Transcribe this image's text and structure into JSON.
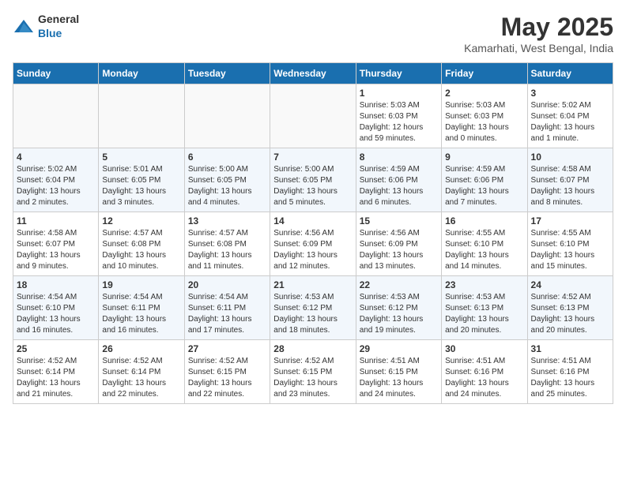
{
  "header": {
    "logo": {
      "general": "General",
      "blue": "Blue"
    },
    "title": "May 2025",
    "location": "Kamarhati, West Bengal, India"
  },
  "calendar": {
    "days_of_week": [
      "Sunday",
      "Monday",
      "Tuesday",
      "Wednesday",
      "Thursday",
      "Friday",
      "Saturday"
    ],
    "weeks": [
      [
        {
          "day": "",
          "info": ""
        },
        {
          "day": "",
          "info": ""
        },
        {
          "day": "",
          "info": ""
        },
        {
          "day": "",
          "info": ""
        },
        {
          "day": "1",
          "info": "Sunrise: 5:03 AM\nSunset: 6:03 PM\nDaylight: 12 hours and 59 minutes."
        },
        {
          "day": "2",
          "info": "Sunrise: 5:03 AM\nSunset: 6:03 PM\nDaylight: 13 hours and 0 minutes."
        },
        {
          "day": "3",
          "info": "Sunrise: 5:02 AM\nSunset: 6:04 PM\nDaylight: 13 hours and 1 minute."
        }
      ],
      [
        {
          "day": "4",
          "info": "Sunrise: 5:02 AM\nSunset: 6:04 PM\nDaylight: 13 hours and 2 minutes."
        },
        {
          "day": "5",
          "info": "Sunrise: 5:01 AM\nSunset: 6:05 PM\nDaylight: 13 hours and 3 minutes."
        },
        {
          "day": "6",
          "info": "Sunrise: 5:00 AM\nSunset: 6:05 PM\nDaylight: 13 hours and 4 minutes."
        },
        {
          "day": "7",
          "info": "Sunrise: 5:00 AM\nSunset: 6:05 PM\nDaylight: 13 hours and 5 minutes."
        },
        {
          "day": "8",
          "info": "Sunrise: 4:59 AM\nSunset: 6:06 PM\nDaylight: 13 hours and 6 minutes."
        },
        {
          "day": "9",
          "info": "Sunrise: 4:59 AM\nSunset: 6:06 PM\nDaylight: 13 hours and 7 minutes."
        },
        {
          "day": "10",
          "info": "Sunrise: 4:58 AM\nSunset: 6:07 PM\nDaylight: 13 hours and 8 minutes."
        }
      ],
      [
        {
          "day": "11",
          "info": "Sunrise: 4:58 AM\nSunset: 6:07 PM\nDaylight: 13 hours and 9 minutes."
        },
        {
          "day": "12",
          "info": "Sunrise: 4:57 AM\nSunset: 6:08 PM\nDaylight: 13 hours and 10 minutes."
        },
        {
          "day": "13",
          "info": "Sunrise: 4:57 AM\nSunset: 6:08 PM\nDaylight: 13 hours and 11 minutes."
        },
        {
          "day": "14",
          "info": "Sunrise: 4:56 AM\nSunset: 6:09 PM\nDaylight: 13 hours and 12 minutes."
        },
        {
          "day": "15",
          "info": "Sunrise: 4:56 AM\nSunset: 6:09 PM\nDaylight: 13 hours and 13 minutes."
        },
        {
          "day": "16",
          "info": "Sunrise: 4:55 AM\nSunset: 6:10 PM\nDaylight: 13 hours and 14 minutes."
        },
        {
          "day": "17",
          "info": "Sunrise: 4:55 AM\nSunset: 6:10 PM\nDaylight: 13 hours and 15 minutes."
        }
      ],
      [
        {
          "day": "18",
          "info": "Sunrise: 4:54 AM\nSunset: 6:10 PM\nDaylight: 13 hours and 16 minutes."
        },
        {
          "day": "19",
          "info": "Sunrise: 4:54 AM\nSunset: 6:11 PM\nDaylight: 13 hours and 16 minutes."
        },
        {
          "day": "20",
          "info": "Sunrise: 4:54 AM\nSunset: 6:11 PM\nDaylight: 13 hours and 17 minutes."
        },
        {
          "day": "21",
          "info": "Sunrise: 4:53 AM\nSunset: 6:12 PM\nDaylight: 13 hours and 18 minutes."
        },
        {
          "day": "22",
          "info": "Sunrise: 4:53 AM\nSunset: 6:12 PM\nDaylight: 13 hours and 19 minutes."
        },
        {
          "day": "23",
          "info": "Sunrise: 4:53 AM\nSunset: 6:13 PM\nDaylight: 13 hours and 20 minutes."
        },
        {
          "day": "24",
          "info": "Sunrise: 4:52 AM\nSunset: 6:13 PM\nDaylight: 13 hours and 20 minutes."
        }
      ],
      [
        {
          "day": "25",
          "info": "Sunrise: 4:52 AM\nSunset: 6:14 PM\nDaylight: 13 hours and 21 minutes."
        },
        {
          "day": "26",
          "info": "Sunrise: 4:52 AM\nSunset: 6:14 PM\nDaylight: 13 hours and 22 minutes."
        },
        {
          "day": "27",
          "info": "Sunrise: 4:52 AM\nSunset: 6:15 PM\nDaylight: 13 hours and 22 minutes."
        },
        {
          "day": "28",
          "info": "Sunrise: 4:52 AM\nSunset: 6:15 PM\nDaylight: 13 hours and 23 minutes."
        },
        {
          "day": "29",
          "info": "Sunrise: 4:51 AM\nSunset: 6:15 PM\nDaylight: 13 hours and 24 minutes."
        },
        {
          "day": "30",
          "info": "Sunrise: 4:51 AM\nSunset: 6:16 PM\nDaylight: 13 hours and 24 minutes."
        },
        {
          "day": "31",
          "info": "Sunrise: 4:51 AM\nSunset: 6:16 PM\nDaylight: 13 hours and 25 minutes."
        }
      ]
    ]
  }
}
